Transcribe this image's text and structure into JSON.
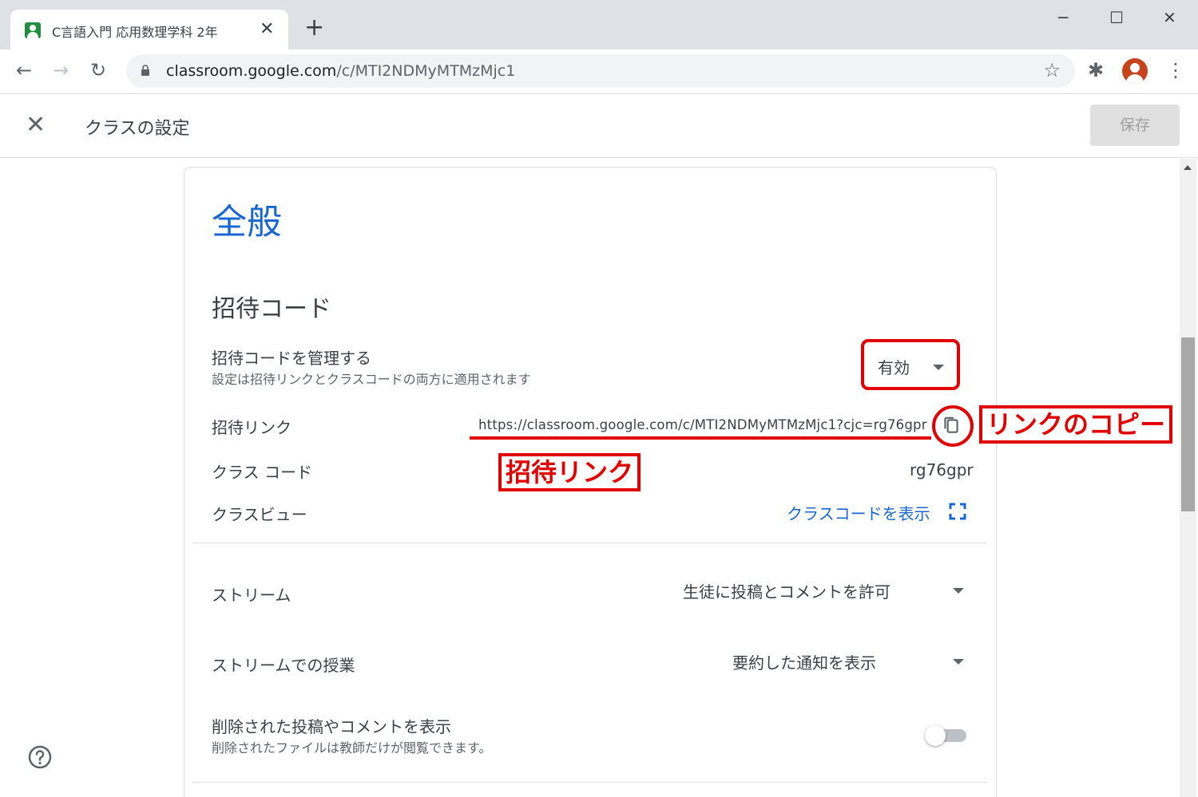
{
  "browser": {
    "tab_title": "C言語入門 応用数理学科 2年",
    "tab_close": "✕",
    "new_tab": "+",
    "window_controls": {
      "minimize": "─",
      "maximize": "☐",
      "close": "✕"
    },
    "back_icon": "←",
    "forward_icon": "→",
    "reload_icon": "↻",
    "url_host": "classroom.google.com",
    "url_path": "/c/MTI2NDMyMTMzMjc1",
    "star_icon": "☆",
    "extensions_icon": "✱",
    "menu_icon": "⋮"
  },
  "header": {
    "close_icon": "✕",
    "title": "クラスの設定",
    "save_label": "保存"
  },
  "general": {
    "section_title": "全般",
    "invite_code": {
      "title": "招待コード",
      "manage_label": "招待コードを管理する",
      "manage_sub": "設定は招待リンクとクラスコードの両方に適用されます",
      "manage_value": "有効",
      "invite_link_label": "招待リンク",
      "invite_link_value": "https://classroom.google.com/c/MTI2NDMyMTMzMjc1?cjc=rg76gpr",
      "class_code_label": "クラス コード",
      "class_code_value": "rg76gpr",
      "class_view_label": "クラスビュー",
      "class_view_link": "クラスコードを表示"
    },
    "stream": {
      "label": "ストリーム",
      "value": "生徒に投稿とコメントを許可"
    },
    "classwork_on_stream": {
      "label": "ストリームでの授業",
      "value": "要約した通知を表示"
    },
    "show_deleted": {
      "label": "削除された投稿やコメントを表示",
      "sub": "削除されたファイルは教師だけが閲覧できます。",
      "enabled": false
    }
  },
  "annotations": {
    "copy_link_label": "リンクのコピー",
    "invite_link_label": "招待リンク",
    "color": "#e00000"
  },
  "colors": {
    "accent": "#1967d2",
    "tabstrip": "#dee1e6",
    "avatar": "#c5441c"
  }
}
